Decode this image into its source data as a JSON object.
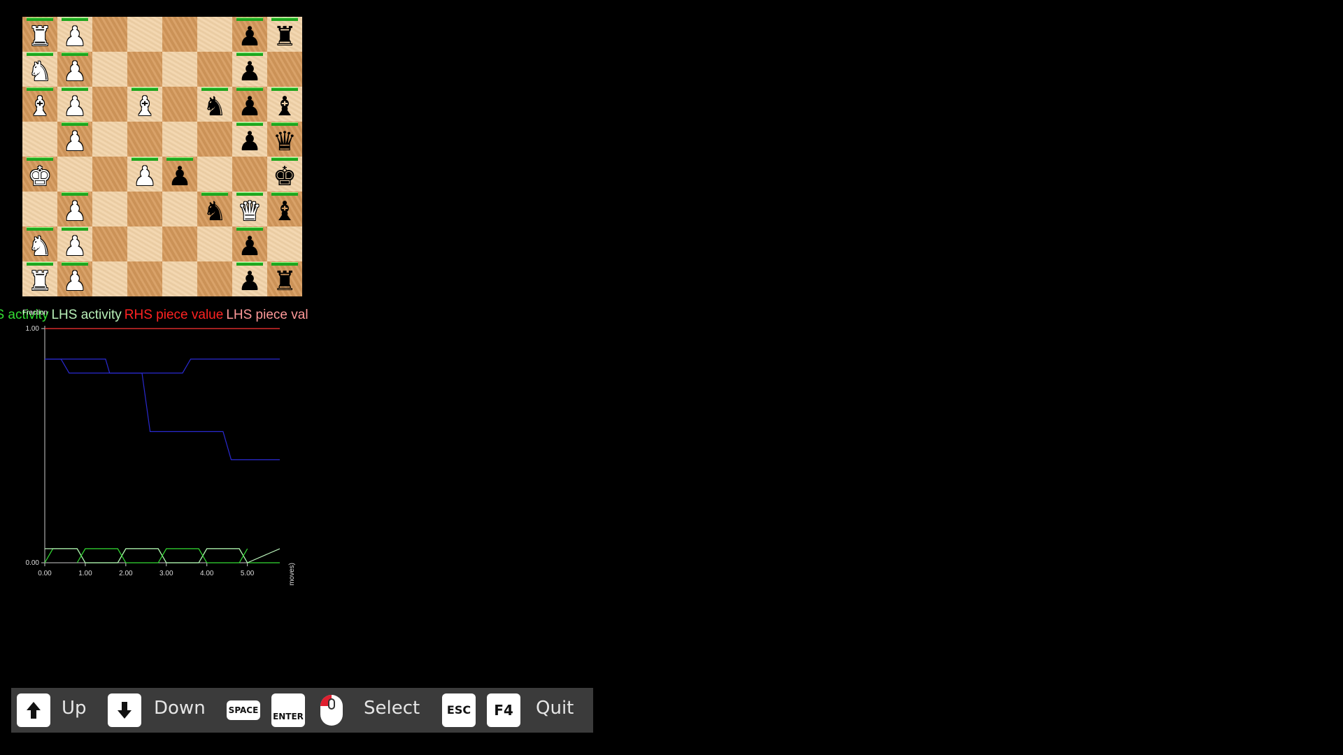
{
  "board": {
    "rows": [
      [
        "wR",
        "wP",
        "",
        "",
        "",
        "",
        "bP",
        "bR"
      ],
      [
        "wN",
        "wP",
        "",
        "",
        "",
        "",
        "bP",
        ""
      ],
      [
        "wB",
        "wP",
        "",
        "wB",
        "",
        "bN",
        "bP",
        "bB"
      ],
      [
        "",
        "wP",
        "",
        "",
        "",
        "",
        "bP",
        "bQ"
      ],
      [
        "wK",
        "",
        "",
        "wP",
        "bP",
        "",
        "",
        "bK"
      ],
      [
        "",
        "wP",
        "",
        "",
        "",
        "bN",
        "wQ",
        "bB"
      ],
      [
        "wN",
        "wP",
        "",
        "",
        "",
        "",
        "bP",
        ""
      ],
      [
        "wR",
        "wP",
        "",
        "",
        "",
        "",
        "bP",
        "bR"
      ]
    ],
    "colors": {
      "light": "#f2d3a8",
      "dark": "#d69a5c",
      "health": "#1ea61e"
    }
  },
  "legend": [
    {
      "text": "RHS activity",
      "color": "#33dd33"
    },
    {
      "text": "LHS activity",
      "color": "#b8f0b8"
    },
    {
      "text": "RHS piece value",
      "color": "#ff2222"
    },
    {
      "text": "LHS piece value",
      "color": "#ff9999"
    }
  ],
  "chart_data": {
    "type": "line",
    "ylabel": "Fraction",
    "xlabel": "Time (chess moves)",
    "xlim": [
      0,
      5.8
    ],
    "ylim": [
      0,
      1
    ],
    "xticks": [
      "0.00",
      "1.00",
      "2.00",
      "3.00",
      "4.00",
      "5.00"
    ],
    "yticks": [
      "0.00",
      "1.00"
    ],
    "series": [
      {
        "color": "#ff3333",
        "x": [
          0,
          5.8
        ],
        "y": [
          1.0,
          1.0
        ]
      },
      {
        "color": "#2a2ad0",
        "x": [
          0,
          0.6,
          1.5,
          1.6,
          3.4,
          3.6,
          5.8
        ],
        "y": [
          0.87,
          0.87,
          0.87,
          0.81,
          0.81,
          0.87,
          0.87
        ]
      },
      {
        "color": "#2a2ad0",
        "x": [
          0,
          0.4,
          0.6,
          2.4,
          2.6,
          4.4,
          4.6,
          5.8
        ],
        "y": [
          0.87,
          0.87,
          0.81,
          0.81,
          0.56,
          0.56,
          0.44,
          0.44
        ]
      },
      {
        "color": "#33dd33",
        "x": [
          0,
          0.2,
          0.8,
          1.0,
          1.8,
          2.0,
          2.8,
          3.0,
          3.8,
          4.0,
          4.8,
          5.0,
          5.8
        ],
        "y": [
          0,
          0.06,
          0.06,
          0,
          0,
          0.06,
          0.06,
          0,
          0,
          0.06,
          0.06,
          0,
          0
        ]
      },
      {
        "color": "#b8f0b8",
        "x": [
          0,
          0.8,
          1.0,
          1.8,
          2.0,
          2.8,
          3.0,
          3.8,
          4.0,
          4.8,
          5.0,
          5.8
        ],
        "y": [
          0.06,
          0.06,
          0,
          0,
          0.06,
          0.06,
          0,
          0,
          0.06,
          0.06,
          0,
          0.06
        ]
      },
      {
        "color": "#33dd33",
        "x": [
          0.8,
          1.0,
          1.8,
          2.0,
          2.8,
          3.0,
          3.8,
          4.0,
          4.8,
          5.0
        ],
        "y": [
          0,
          0.06,
          0.06,
          0,
          0,
          0.06,
          0.06,
          0,
          0,
          0.06
        ]
      }
    ]
  },
  "bottombar": {
    "up_label": "Up",
    "down_label": "Down",
    "space_key": "SPACE",
    "enter_key": "ENTER",
    "select_label": "Select",
    "esc_key": "ESC",
    "f4_key": "F4",
    "quit_label": "Quit"
  }
}
